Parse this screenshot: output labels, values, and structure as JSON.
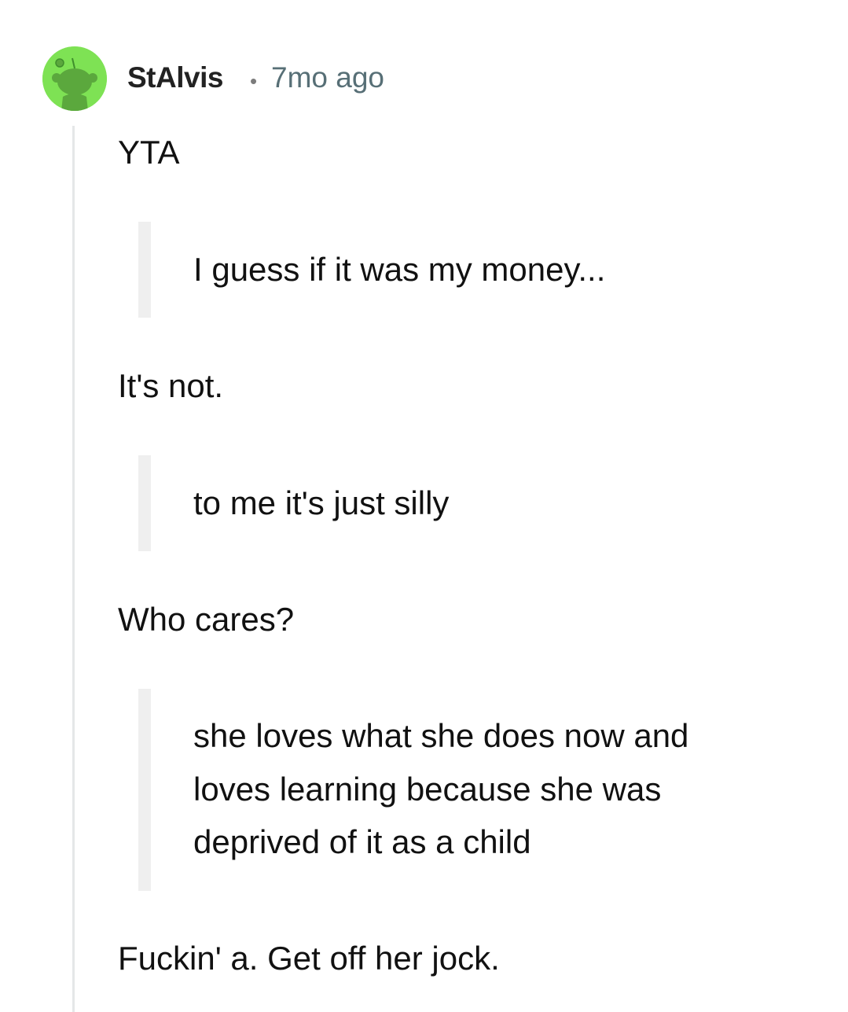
{
  "comment": {
    "username": "StAlvis",
    "separator": "•",
    "timestamp": "7mo ago",
    "avatar_icon": "snoo-avatar-icon",
    "avatar_color": "#7ee254",
    "body": {
      "p1": "YTA",
      "quote1": "I guess if it was my money...",
      "p2": "It's not.",
      "quote2": "to me it's just silly",
      "p3": "Who cares?",
      "quote3_line1": "she loves what she does now and",
      "quote3_line2": "loves learning because she was",
      "quote3_line3": "deprived of it as a child",
      "p4": "Fuckin' a. Get off her jock."
    }
  }
}
